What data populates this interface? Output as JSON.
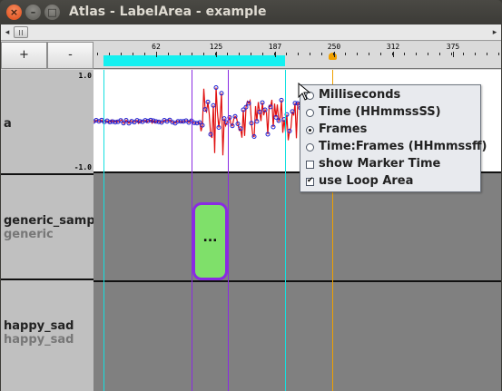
{
  "window": {
    "title": "Atlas - LabelArea - example",
    "close_glyph": "×",
    "min_glyph": "–",
    "max_glyph": "□"
  },
  "scrollbar": {
    "left_arrow": "◂",
    "right_arrow": "▸"
  },
  "zoom": {
    "in_label": "+",
    "out_label": "-"
  },
  "ruler": {
    "ticks": [
      "62",
      "125",
      "187",
      "250",
      "312",
      "375"
    ]
  },
  "colors": {
    "loop_area": "#14f0f0",
    "marker": "#f0a000",
    "segment_fill": "#7fe06a",
    "segment_border": "#8a2be2",
    "wave_blue": "#2020d0",
    "wave_red": "#e01010"
  },
  "tracks": [
    {
      "name": "a",
      "y_max": "1.0",
      "y_min": "-1.0"
    },
    {
      "name": "generic_sampl",
      "sub": "generic"
    },
    {
      "name": "happy_sad",
      "sub": "happy_sad"
    }
  ],
  "segment": {
    "label": "..."
  },
  "menu": {
    "items": [
      {
        "label": "Milliseconds",
        "kind": "radio",
        "selected": false
      },
      {
        "label": "Time (HHmmssSS)",
        "kind": "radio",
        "selected": false
      },
      {
        "label": "Frames",
        "kind": "radio",
        "selected": true
      },
      {
        "label": "Time:Frames (HHmmssff)",
        "kind": "radio",
        "selected": false
      },
      {
        "label": "show Marker Time",
        "kind": "check",
        "selected": false
      },
      {
        "label": "use Loop Area",
        "kind": "check",
        "selected": true
      }
    ]
  },
  "icons": {
    "close": "close-icon",
    "minimize": "minimize-icon",
    "maximize": "maximize-icon",
    "cursor": "pointer-cursor-icon"
  }
}
